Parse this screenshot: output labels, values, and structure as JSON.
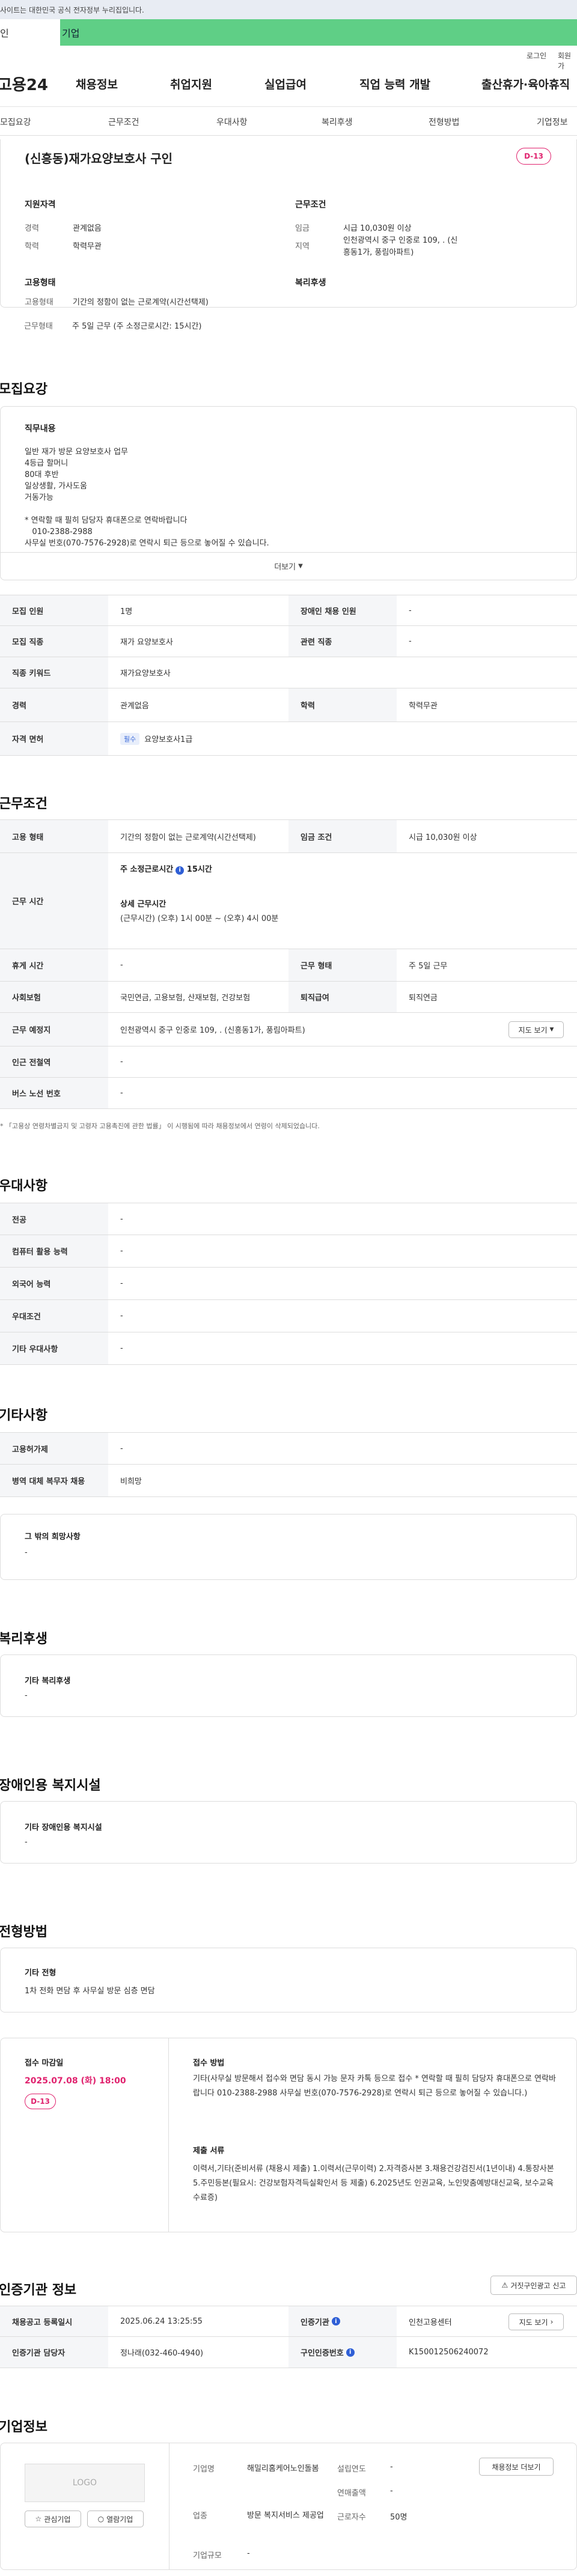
{
  "gov_bar": {
    "text": "사이트는 대한민국 공식 전자정부 누리집입니다."
  },
  "top_tabs": [
    "인",
    "기업"
  ],
  "util": {
    "login": "로그인",
    "signup": "회원가"
  },
  "gnb": {
    "logo": "고용24",
    "menu": [
      "채용정보",
      "취업지원",
      "실업급여",
      "직업 능력 개발",
      "출산휴가·육아휴직"
    ]
  },
  "anchors": [
    "모집요강",
    "근무조건",
    "우대사항",
    "복리후생",
    "전형방법",
    "기업정보"
  ],
  "header": {
    "title": "(신흥동)재가요양보호사 구인",
    "dday": "D-13",
    "qual": {
      "title": "지원자격",
      "career_lbl": "경력",
      "career": "관계없음",
      "edu_lbl": "학력",
      "edu": "학력무관"
    },
    "cond": {
      "title": "근무조건",
      "wage_lbl": "임금",
      "wage": "시급 10,030원 이상",
      "area_lbl": "지역",
      "area": "인천광역시 중구 인중로 109, . (신흥동1가, 풍림아파트)"
    },
    "emp": {
      "title": "고용형태",
      "type_lbl": "고용형태",
      "type": "기간의 정함이 없는 근로계약(시간선택제)",
      "hours_lbl": "근무형태",
      "hours": "주 5일 근무 (주 소정근로시간: 15시간)"
    },
    "welfare": {
      "title": "복리후생"
    }
  },
  "recruit": {
    "title": "모집요강",
    "duty_title": "직무내용",
    "duty_lines": [
      "일반 재가 방문 요양보호사 업무",
      "4등급 할머니",
      "80대 후반",
      "일상생활, 가사도움",
      "거동가능",
      "",
      "* 연락할 때 필히 담당자 휴대폰으로 연락바랍니다",
      "   010-2388-2988",
      "사무실 번호(070-7576-2928)로 연락시 퇴근 등으로 놓어질 수 있습니다."
    ],
    "more": "더보기",
    "rows": {
      "count_lbl": "모집 인원",
      "count": "1명",
      "disabled_lbl": "장애인 채용 인원",
      "disabled": "-",
      "job_lbl": "모집 직종",
      "job": "재가 요양보호사",
      "rel_lbl": "관련 직종",
      "rel": "-",
      "kw_lbl": "직종 키워드",
      "kw": "재가요양보호사",
      "career_lbl": "경력",
      "career": "관계없음",
      "edu_lbl": "학력",
      "edu": "학력무관",
      "lic_lbl": "자격 면허",
      "lic_tag": "필수",
      "lic": "요양보호사1급"
    }
  },
  "work": {
    "title": "근무조건",
    "type_lbl": "고용 형태",
    "type": "기간의 정함이 없는 근로계약(시간선택제)",
    "wage_lbl": "임금 조건",
    "wage": "시급 10,030원 이상",
    "time_lbl": "근무 시간",
    "weekly": "주 소정근로시간",
    "weekly_val": "15시간",
    "detail_title": "상세 근무시간",
    "detail": "(근무시간) (오후) 1시 00분 ~ (오후) 4시 00분",
    "rest_lbl": "휴게 시간",
    "rest": "-",
    "form_lbl": "근무 형태",
    "form": "주 5일 근무",
    "ins_lbl": "사회보험",
    "ins": "국민연금, 고용보험, 산재보험, 건강보험",
    "ret_lbl": "퇴직급여",
    "ret": "퇴직연금",
    "place_lbl": "근무 예정지",
    "place": "인천광역시 중구 인중로 109, . (신흥동1가, 풍림아파트)",
    "map_btn": "지도 보기",
    "subway_lbl": "인근 전철역",
    "subway": "-",
    "bus_lbl": "버스 노선 번호",
    "bus": "-",
    "note": "* 「고용상 연령차별금지 및 고령자 고용촉진에 관한 법률」 이 시행됨에 따라 채용정보에서 연령이 삭제되었습니다."
  },
  "pref": {
    "title": "우대사항",
    "rows": [
      {
        "k": "전공",
        "v": "-"
      },
      {
        "k": "컴퓨터 활용 능력",
        "v": "-"
      },
      {
        "k": "외국어 능력",
        "v": "-"
      },
      {
        "k": "우대조건",
        "v": "-"
      },
      {
        "k": "기타 우대사항",
        "v": "-"
      }
    ]
  },
  "etc": {
    "title": "기타사항",
    "rows": [
      {
        "k": "고용허가제",
        "v": "-"
      },
      {
        "k": "병역 대체 복무자 채용",
        "v": "비희망"
      }
    ],
    "other_title": "그 밖의 희망사항",
    "other": "-"
  },
  "welfare": {
    "title": "복리후생",
    "box_title": "기타 복리후생",
    "box_val": "-"
  },
  "facility": {
    "title": "장애인용 복지시설",
    "box_title": "기타 장애인용 복지시설",
    "box_val": "-"
  },
  "selection": {
    "title": "전형방법",
    "other_title": "기타 전형",
    "other": "1차 전화 면담 후 사무실 방문 심층 면담",
    "deadline_lbl": "접수 마감일",
    "deadline": "2025.07.08 (화) 18:00",
    "dday": "D-13",
    "method_lbl": "접수 방법",
    "method": "기타(사무실 방문해서 접수와 면담 동시 가능 문자 카톡 등으로 접수 * 연락할 때 필히 담당자 휴대폰으로 연락바랍니다    010-2388-2988  사무실 번호(070-7576-2928)로 연락시 퇴근 등으로 놓어질 수 있습니다.)",
    "docs_lbl": "제출 서류",
    "docs": "이력서,기타(준비서류 (채용시 제출) 1.이력서(근무이력) 2.자격증사본 3.채용건강검진서(1년이내) 4.통장사본 5.주민등본(필요시: 건강보험자격득실확인서 등 제출) 6.2025년도 인권교육, 노인맞춤예방대신교육, 보수교육 수료증)"
  },
  "agency": {
    "title": "인증기관 정보",
    "report_btn": "거짓구인광고 신고",
    "reg_lbl": "채용공고 등록일시",
    "reg": "2025.06.24 13:25:55",
    "org_lbl": "인증기관",
    "org": "인천고용센터",
    "map_btn": "지도 보기",
    "mgr_lbl": "인증기관 담당자",
    "mgr": "정나래(032-460-4940)",
    "no_lbl": "구인인증번호",
    "no": "K150012506240072"
  },
  "company": {
    "title": "기업정보",
    "logo": "LOGO",
    "fav_btn": "관심기업",
    "check_btn": "열람기업",
    "name_lbl": "기업명",
    "name": "해밀리홈케어노인돌봄",
    "founded_lbl": "설립연도",
    "founded": "-",
    "sales_lbl": "연매출액",
    "sales": "-",
    "biz_lbl": "업종",
    "biz": "방문 복지서비스 제공업",
    "emp_lbl": "근로자수",
    "emp": "50명",
    "size_lbl": "기업규모",
    "size": "-",
    "info_btn": "채용정보 더보기"
  },
  "colors": {
    "accent": "#e0226e",
    "tab_green": "#5fcf86",
    "primary_blue": "#2f5fd6"
  }
}
